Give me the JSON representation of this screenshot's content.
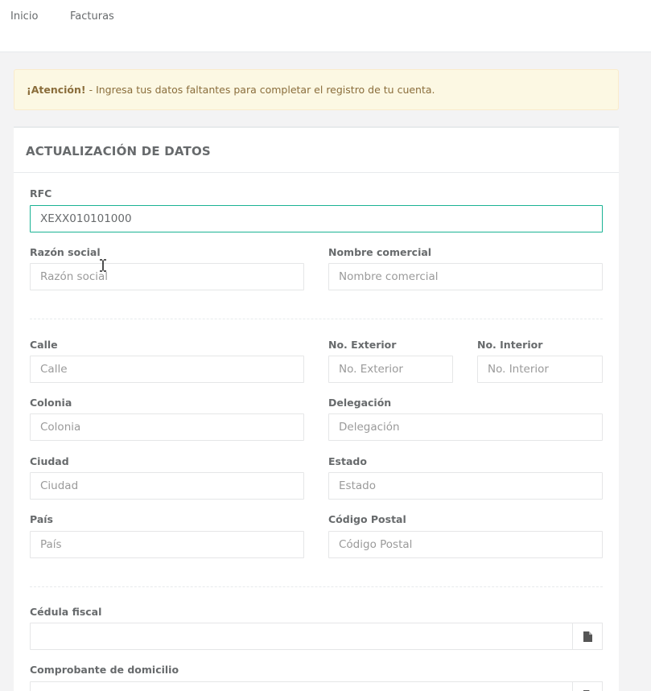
{
  "nav": {
    "home_label": "Inicio",
    "invoices_label": "Facturas"
  },
  "alert": {
    "strong": "¡Atención!",
    "message": " - Ingresa tus datos faltantes para completar el registro de tu cuenta."
  },
  "panel": {
    "title": "ACTUALIZACIÓN DE DATOS"
  },
  "form": {
    "rfc": {
      "label": "RFC",
      "value": "XEXX010101000"
    },
    "razon_social": {
      "label": "Razón social",
      "placeholder": "Razón social"
    },
    "nombre_comercial": {
      "label": "Nombre comercial",
      "placeholder": "Nombre comercial"
    },
    "calle": {
      "label": "Calle",
      "placeholder": "Calle"
    },
    "no_exterior": {
      "label": "No. Exterior",
      "placeholder": "No. Exterior"
    },
    "no_interior": {
      "label": "No. Interior",
      "placeholder": "No. Interior"
    },
    "colonia": {
      "label": "Colonia",
      "placeholder": "Colonia"
    },
    "delegacion": {
      "label": "Delegación",
      "placeholder": "Delegación"
    },
    "ciudad": {
      "label": "Ciudad",
      "placeholder": "Ciudad"
    },
    "estado": {
      "label": "Estado",
      "placeholder": "Estado"
    },
    "pais": {
      "label": "País",
      "placeholder": "País"
    },
    "codigo_postal": {
      "label": "Código Postal",
      "placeholder": "Código Postal"
    },
    "cedula_fiscal": {
      "label": "Cédula fiscal",
      "icon": "file-icon"
    },
    "comprobante_domicilio": {
      "label": "Comprobante de domicilio",
      "icon": "file-icon"
    }
  },
  "colors": {
    "accent": "#1ab394",
    "alert_bg": "#fcf8e3",
    "alert_text": "#8a6d3b"
  }
}
